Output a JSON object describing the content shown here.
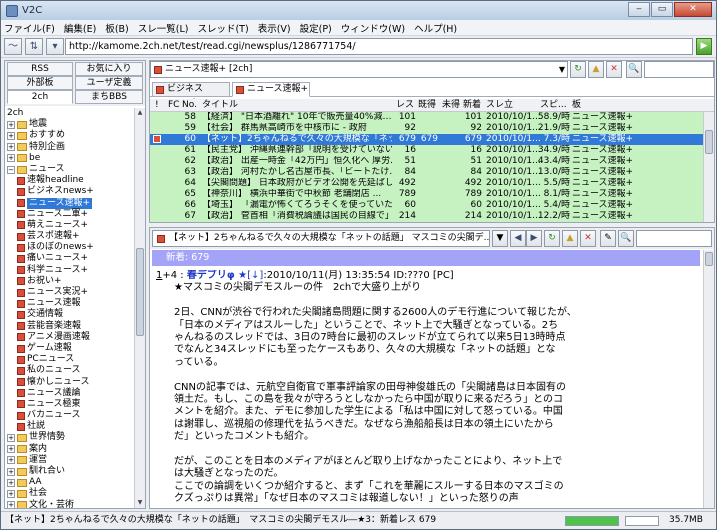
{
  "window": {
    "title": "V2C"
  },
  "menu": [
    "ファイル(F)",
    "編集(E)",
    "板(B)",
    "スレ一覧(L)",
    "スレッド(T)",
    "表示(V)",
    "設定(P)",
    "ウィンドウ(W)",
    "ヘルプ(H)"
  ],
  "url": "http://kamome.2ch.net/test/read.cgi/newsplus/1286771754/",
  "left_tabs": {
    "rss": "RSS",
    "favorites": "お気に入り",
    "external": "外部板",
    "user_defined": "ユーザ定義",
    "ch2": "2ch",
    "machi": "まちBBS"
  },
  "tree": {
    "root": "2ch",
    "items": [
      {
        "label": "地震",
        "type": "folder",
        "expander": "+"
      },
      {
        "label": "おすすめ",
        "type": "folder",
        "expander": "+"
      },
      {
        "label": "特別企画",
        "type": "folder",
        "expander": "+"
      },
      {
        "label": "be",
        "type": "folder",
        "expander": "+"
      },
      {
        "label": "ニュース",
        "type": "folder",
        "expander": "−"
      },
      {
        "label": "速報headline",
        "type": "board"
      },
      {
        "label": "ビジネスnews+",
        "type": "board"
      },
      {
        "label": "ニュース速報+",
        "type": "board",
        "selected": true
      },
      {
        "label": "ニュース二軍+",
        "type": "board"
      },
      {
        "label": "萌えニュース+",
        "type": "board"
      },
      {
        "label": "芸スポ速報+",
        "type": "board"
      },
      {
        "label": "ほのぼのnews+",
        "type": "board"
      },
      {
        "label": "痛いニュース+",
        "type": "board"
      },
      {
        "label": "科学ニュース+",
        "type": "board"
      },
      {
        "label": "お祝い+",
        "type": "board"
      },
      {
        "label": "ニュース実況+",
        "type": "board"
      },
      {
        "label": "ニュース速報",
        "type": "board"
      },
      {
        "label": "交通情報",
        "type": "board"
      },
      {
        "label": "芸能音楽速報",
        "type": "board"
      },
      {
        "label": "アニメ漫画速報",
        "type": "board"
      },
      {
        "label": "ゲーム速報",
        "type": "board"
      },
      {
        "label": "PCニュース",
        "type": "board"
      },
      {
        "label": "私のニュース",
        "type": "board"
      },
      {
        "label": "懐かしニュース",
        "type": "board"
      },
      {
        "label": "ニュース議論",
        "type": "board"
      },
      {
        "label": "ニュース極東",
        "type": "board"
      },
      {
        "label": "バカニュース",
        "type": "board"
      },
      {
        "label": "社説",
        "type": "board"
      },
      {
        "label": "世界情勢",
        "type": "folder",
        "expander": "+"
      },
      {
        "label": "案内",
        "type": "folder",
        "expander": "+"
      },
      {
        "label": "運営",
        "type": "folder",
        "expander": "+"
      },
      {
        "label": "馴れ合い",
        "type": "folder",
        "expander": "+"
      },
      {
        "label": "AA",
        "type": "folder",
        "expander": "+"
      },
      {
        "label": "社会",
        "type": "folder",
        "expander": "+"
      },
      {
        "label": "文化・芸術",
        "type": "folder",
        "expander": "+"
      }
    ]
  },
  "list": {
    "board_combo": "ニュース速報+ [2ch]",
    "tabs": [
      "ビジネスnews+",
      "ニュース速報+"
    ],
    "columns": {
      "mark": "!",
      "fc": "FC",
      "no": "No.",
      "title": "タイトル",
      "res": "レス",
      "read": "既得",
      "unread": "未得",
      "new": "新着",
      "since": "スレ立",
      "speed": "スピ...",
      "board": "板"
    },
    "rows": [
      {
        "no": "58",
        "title": "【経済】 \"日本酒離れ\" 10年で販売量40%減…",
        "res": "101",
        "read": "",
        "new": "101",
        "since": "2010/10/1...",
        "speed": "58.9/時",
        "board": "ニュース速報+"
      },
      {
        "no": "59",
        "title": "【社会】 群馬県高崎市を中核市に - 政府",
        "res": "92",
        "read": "",
        "new": "92",
        "since": "2010/10/1...",
        "speed": "21.9/時",
        "board": "ニュース速報+"
      },
      {
        "no": "60",
        "title": "【ネット】2ちゃんねるで久々の大規模な「ネッ...",
        "res": "679",
        "read": "679",
        "new": "679",
        "since": "2010/10/1...",
        "speed": "7.3/時",
        "board": "ニュース速報+",
        "selected": true
      },
      {
        "no": "61",
        "title": "【民主党】 沖縄県連幹部「説明を受けていない」...",
        "res": "16",
        "read": "",
        "new": "16",
        "since": "2010/10/1...",
        "speed": "34.9/時",
        "board": "ニュース速報+"
      },
      {
        "no": "62",
        "title": "【政治】 出産一時金「42万円」恒久化へ 厚労...",
        "res": "51",
        "read": "",
        "new": "51",
        "since": "2010/10/1...",
        "speed": "43.4/時",
        "board": "ニュース速報+"
      },
      {
        "no": "63",
        "title": "【政治】 河村たかし名古屋市長、「ビートたけ...",
        "res": "84",
        "read": "",
        "new": "84",
        "since": "2010/10/1...",
        "speed": "13.0/時",
        "board": "ニュース速報+"
      },
      {
        "no": "64",
        "title": "【尖閣問題】 日本政府がビデオ公開を先延ばし検...",
        "res": "492",
        "read": "",
        "new": "492",
        "since": "2010/10/1...",
        "speed": "5.5/時",
        "board": "ニュース速報+"
      },
      {
        "no": "65",
        "title": "【神奈川】 横浜中華街で中秋節 老舗閉店 ...",
        "res": "789",
        "read": "",
        "new": "789",
        "since": "2010/10/1...",
        "speed": "8.1/時",
        "board": "ニュース速報+"
      },
      {
        "no": "66",
        "title": "【埼玉】 「漏電が怖くてろうそくを使っていた」...",
        "res": "60",
        "read": "",
        "new": "60",
        "since": "2010/10/1...",
        "speed": "5.4/時",
        "board": "ニュース速報+"
      },
      {
        "no": "67",
        "title": "【政治】 菅首相「消費税論議は国民の目線で」...",
        "res": "214",
        "read": "",
        "new": "214",
        "since": "2010/10/1...",
        "speed": "12.2/時",
        "board": "ニュース速報+"
      }
    ]
  },
  "view": {
    "title": "【ネット】2ちゃんねるで久々の大規模な「ネットの話題」 マスコミの尖閣デ...",
    "new_count": "新着: 679",
    "post": {
      "num": "1",
      "plus": "+4",
      "name": "春デブリφ ★",
      "mail": "[↓]",
      "date": ":2010/10/11(月) 13:35:54 ID:???0 [PC]"
    },
    "body": [
      "★マスコミの尖閣デモスルーの件　2chで大盛り上がり",
      "2日、CNNが渋谷で行われた尖閣諸島問題に関する2600人のデモ行進について報じたが、\n「日本のメディアはスルーした」ということで、ネット上で大騒ぎとなっている。2ち\nゃんねるのスレッドでは、3日の7時台に最初のスレッドが立てられて以来5日13時時点\nでなんと34スレッドにも至ったケースもあり、久々の大規模な「ネットの話題」とな\nっている。",
      "CNNの記事では、元航空自衛官で軍事評論家の田母神俊雄氏の「尖閣諸島は日本固有の\n領土だ。もし、この島を我々が守ろうとしなかったら中国が取りに来るだろう」とのコ\nメントを紹介。また、デモに参加した学生による「私は中国に対して怒っている。中国\nは謝罪し、巡視船の修理代を払うべきだ。なぜなら漁船船長は日本の領土にいたから\nだ」といったコメントも紹介。",
      "だが、このことを日本のメディアがほとんど取り上げなかったことにより、ネット上で\nは大騒ぎとなったのだ。\nここでの論調をいくつか紹介すると、まず「これを華麗にスルーする日本のマスゴミの\nクズっぷりは異常」「なぜ日本のマスコミは報道しない！」といった怒りの声"
    ]
  },
  "status": {
    "text": "【ネット】2ちゃんねるで久々の大規模な「ネットの話題」　マスコミの尖閣デモスル―★3：新着レス 679",
    "progress": 1.0,
    "memory": "35.7MB"
  },
  "colors": {
    "list_row_bg": "#c6f2c2",
    "selection": "#3179d6",
    "new_bar": "#a3a3f7",
    "name_blue": "#1f37c9"
  }
}
